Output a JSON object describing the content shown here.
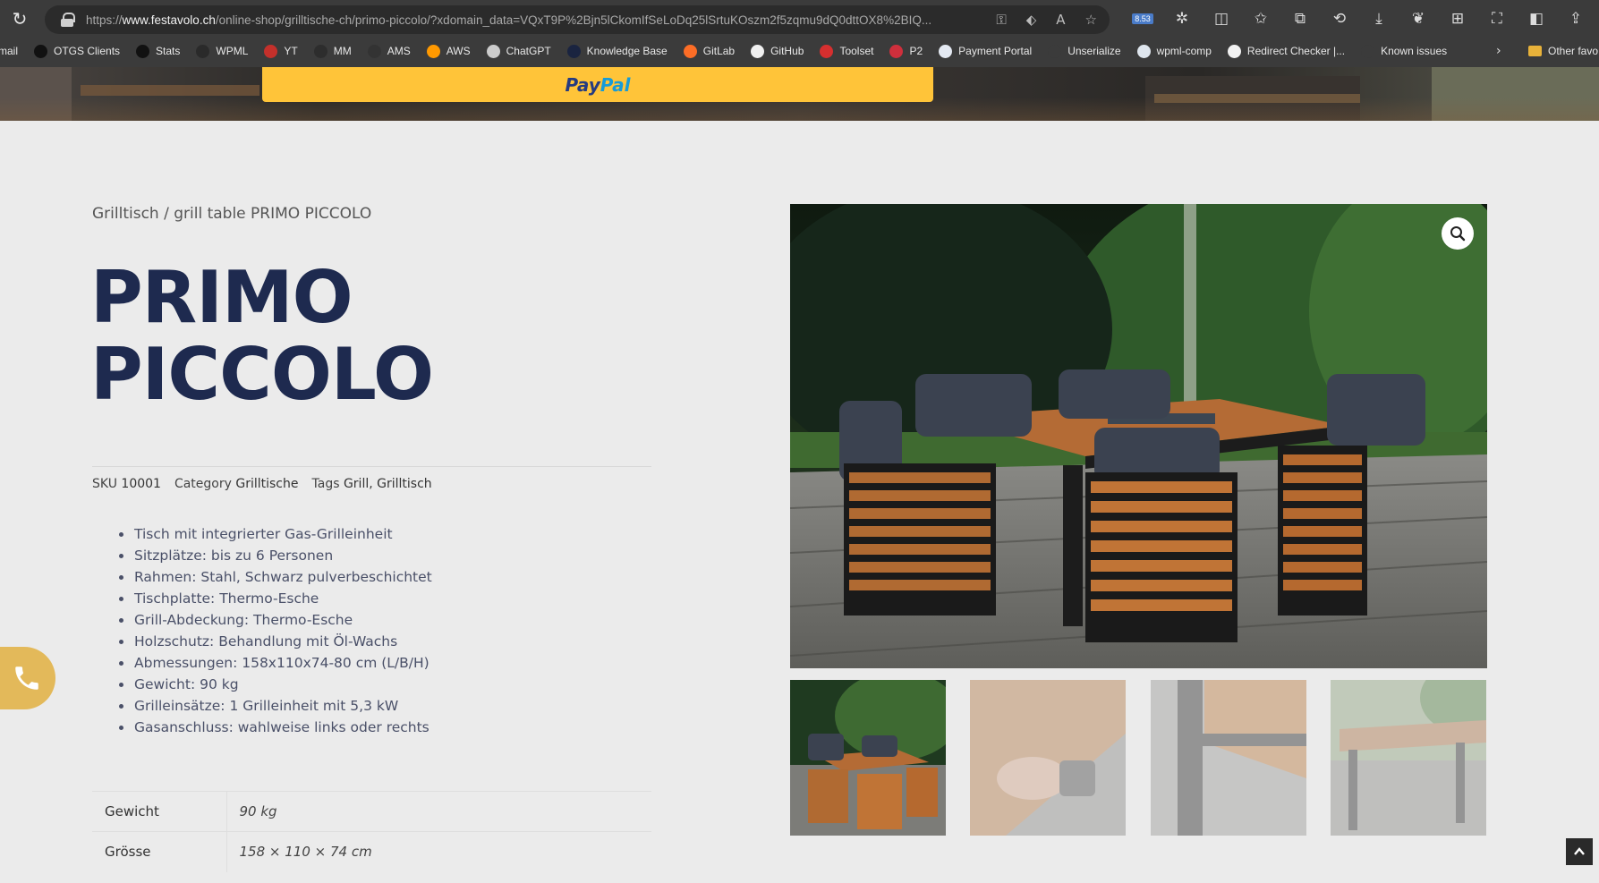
{
  "browser": {
    "url_prefix": "https://",
    "url_host": "www.festavolo.ch",
    "url_path": "/online-shop/grilltische-ch/primo-piccolo/?xdomain_data=VQxT9P%2Bjn5lCkomIfSeLoDq25lSrtuKOszm2f5zqmu9dQ0dttOX8%2BIQ...",
    "badge": "8.53",
    "bookmarks": [
      {
        "label": "mail",
        "icon": "mail-icon",
        "color": "#3b3b3b"
      },
      {
        "label": "OTGS Clients",
        "icon": "otgs-icon",
        "color": "#111111"
      },
      {
        "label": "Stats",
        "icon": "stats-icon",
        "color": "#111111"
      },
      {
        "label": "WPML",
        "icon": "wpml-icon",
        "color": "#2a2a2a"
      },
      {
        "label": "YT",
        "icon": "yt-icon",
        "color": "#c4302b"
      },
      {
        "label": "MM",
        "icon": "mm-icon",
        "color": "#2d2d2d"
      },
      {
        "label": "AMS",
        "icon": "ams-icon",
        "color": "#333333"
      },
      {
        "label": "AWS",
        "icon": "aws-icon",
        "color": "#ff9900"
      },
      {
        "label": "ChatGPT",
        "icon": "doc-icon",
        "color": "#cccccc"
      },
      {
        "label": "Knowledge Base",
        "icon": "kb-icon",
        "color": "#1a2440"
      },
      {
        "label": "GitLab",
        "icon": "gitlab-icon",
        "color": "#fc6d26"
      },
      {
        "label": "GitHub",
        "icon": "github-icon",
        "color": "#f0f0f0"
      },
      {
        "label": "Toolset",
        "icon": "toolset-icon",
        "color": "#d62f2f"
      },
      {
        "label": "P2",
        "icon": "p2-icon",
        "color": "#cf2f3c"
      },
      {
        "label": "Payment Portal",
        "icon": "payment-icon",
        "color": "#e4e9f2"
      },
      {
        "label": "Unserialize",
        "icon": "unserialize-icon",
        "color": "#3b3b3b"
      },
      {
        "label": "wpml-comp",
        "icon": "wordpress-icon",
        "color": "#dfe6ee"
      },
      {
        "label": "Redirect Checker |...",
        "icon": "redirect-icon",
        "color": "#f2f2f2"
      },
      {
        "label": "Known issues",
        "icon": "known-issues-icon",
        "color": "#3b3b3b"
      }
    ],
    "other_favorites": "Other favo"
  },
  "paypal": {
    "part1": "Pay",
    "part2": "Pal"
  },
  "product": {
    "breadcrumb": "Grilltisch / grill table PRIMO PICCOLO",
    "title_line1": "PRIMO",
    "title_line2": "PICCOLO",
    "sku_label": "SKU",
    "sku": "10001",
    "category_label": "Category",
    "category": "Grilltische",
    "tags_label": "Tags",
    "tags": "Grill, Grilltisch",
    "features": [
      "Tisch mit integrierter Gas-Grilleinheit",
      "Sitzplätze: bis zu 6 Personen",
      "Rahmen: Stahl, Schwarz pulverbeschichtet",
      "Tischplatte: Thermo-Esche",
      "Grill-Abdeckung: Thermo-Esche",
      "Holzschutz: Behandlung mit Öl-Wachs",
      "Abmessungen: 158x110x74-80 cm (L/B/H)",
      "Gewicht: 90 kg",
      "Grilleinsätze: 1 Grilleinheit mit 5,3 kW",
      "Gasanschluss: wahlweise links oder rechts"
    ],
    "specs": [
      {
        "key": "Gewicht",
        "value": "90 kg"
      },
      {
        "key": "Grösse",
        "value": "158 × 110 × 74 cm"
      }
    ]
  },
  "colors": {
    "title": "#1e2a4f",
    "paypal_yellow": "#ffc439",
    "phone_button": "#e3b95a",
    "page_bg": "#ebebeb"
  }
}
